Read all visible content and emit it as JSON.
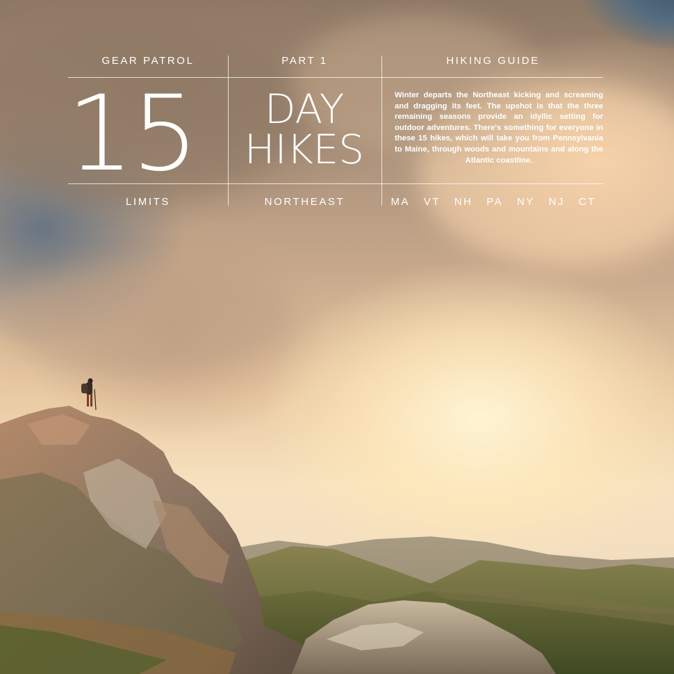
{
  "header": {
    "brand": "GEAR PATROL",
    "part": "PART 1",
    "category": "HIKING GUIDE",
    "number": "15",
    "title_line1": "DAY",
    "title_line2": "HIKES",
    "limits": "LIMITS",
    "region": "NORTHEAST",
    "states": [
      "MA",
      "VT",
      "NH",
      "PA",
      "NY",
      "NJ",
      "CT"
    ]
  },
  "description": "Winter departs the Northeast kicking and screaming and dragging its feet. The upshot is that the three remaining seasons provide an idyllic setting for outdoor adventures. There's something for everyone in these 15 hikes, which will take you from Pennsylvania to Maine, through woods and mountains and along the Atlantic coastline.",
  "colors": {
    "text": "#ffffff",
    "sky_warm": "#f6e2bf",
    "rock": "#8a7a6a",
    "hill_green": "#5c6a3a"
  }
}
